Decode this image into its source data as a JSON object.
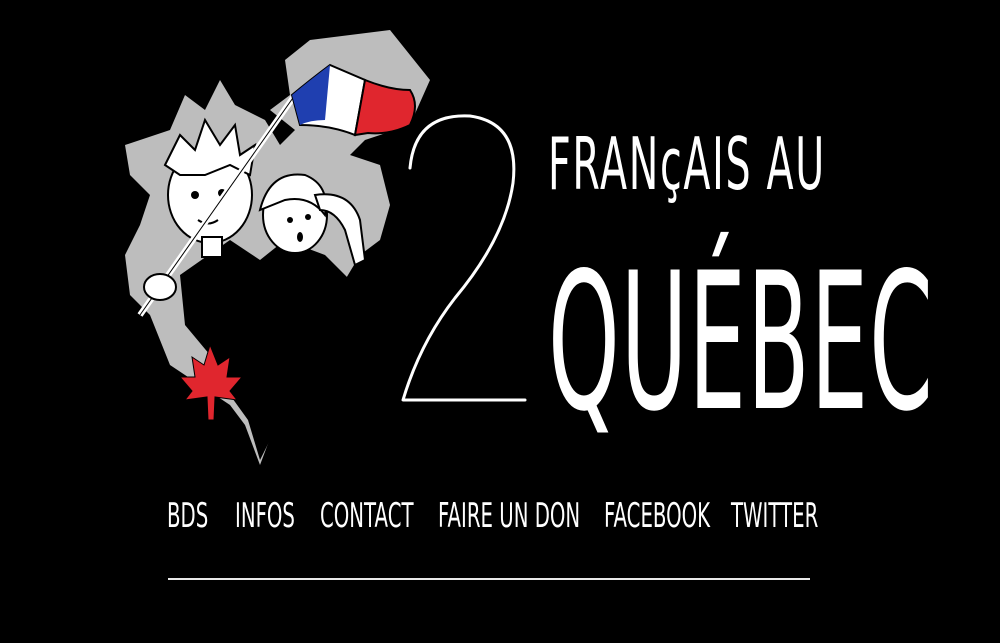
{
  "brand": {
    "title_line1": "FRANçAIS AU",
    "title_line2": "QUÉBEC",
    "numeral": "2"
  },
  "nav": [
    {
      "label": "BDS"
    },
    {
      "label": "INFOS"
    },
    {
      "label": "CONTACT"
    },
    {
      "label": "FAIRE UN DON"
    },
    {
      "label": "FACEBOOK"
    },
    {
      "label": "TWITTER"
    }
  ],
  "colors": {
    "background": "#000000",
    "text": "#ffffff",
    "flag_blue": "#1f3fb0",
    "flag_red": "#e0262e",
    "maple_red": "#e0262e",
    "sticker_grey": "#bdbdbd"
  }
}
